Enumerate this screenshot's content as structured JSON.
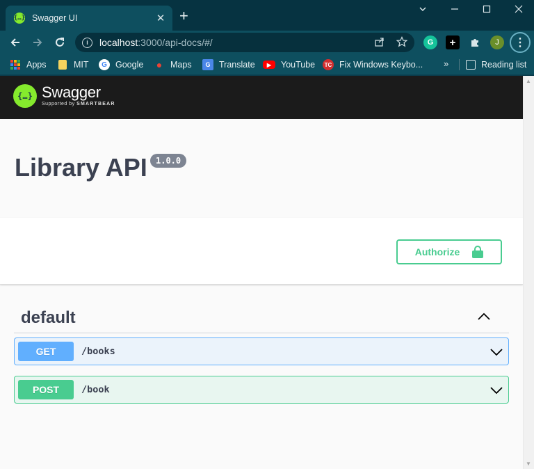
{
  "browser": {
    "tab_title": "Swagger UI",
    "favicon_glyph": "{…}",
    "new_tab_glyph": "+",
    "close_tab_glyph": "✕",
    "url_host": "localhost",
    "url_rest": ":3000/api-docs/#/",
    "profile_initial": "J",
    "extensions": [
      {
        "name": "grammarly-icon",
        "glyph": "G"
      },
      {
        "name": "plus-extension-icon",
        "glyph": "+"
      },
      {
        "name": "puzzle-icon",
        "glyph": "✚"
      }
    ],
    "accent_color": "#0e4f5f"
  },
  "bookmarks": {
    "items": [
      {
        "label": "Apps"
      },
      {
        "label": "MIT"
      },
      {
        "label": "Google"
      },
      {
        "label": "Maps"
      },
      {
        "label": "Translate"
      },
      {
        "label": "YouTube"
      },
      {
        "label": "Fix Windows Keybo..."
      }
    ],
    "more_glyph": "»",
    "reading_list": "Reading list"
  },
  "swagger": {
    "brand": "Swagger",
    "supported_by": "Supported by",
    "smartbear": "SMARTBEAR",
    "logo_glyph": "{…}",
    "api_title": "Library API",
    "version": "1.0.0",
    "authorize_label": "Authorize",
    "tag": "default",
    "operations": [
      {
        "method": "GET",
        "path": "/books",
        "color": "#61affe"
      },
      {
        "method": "POST",
        "path": "/book",
        "color": "#49cc90"
      }
    ]
  }
}
